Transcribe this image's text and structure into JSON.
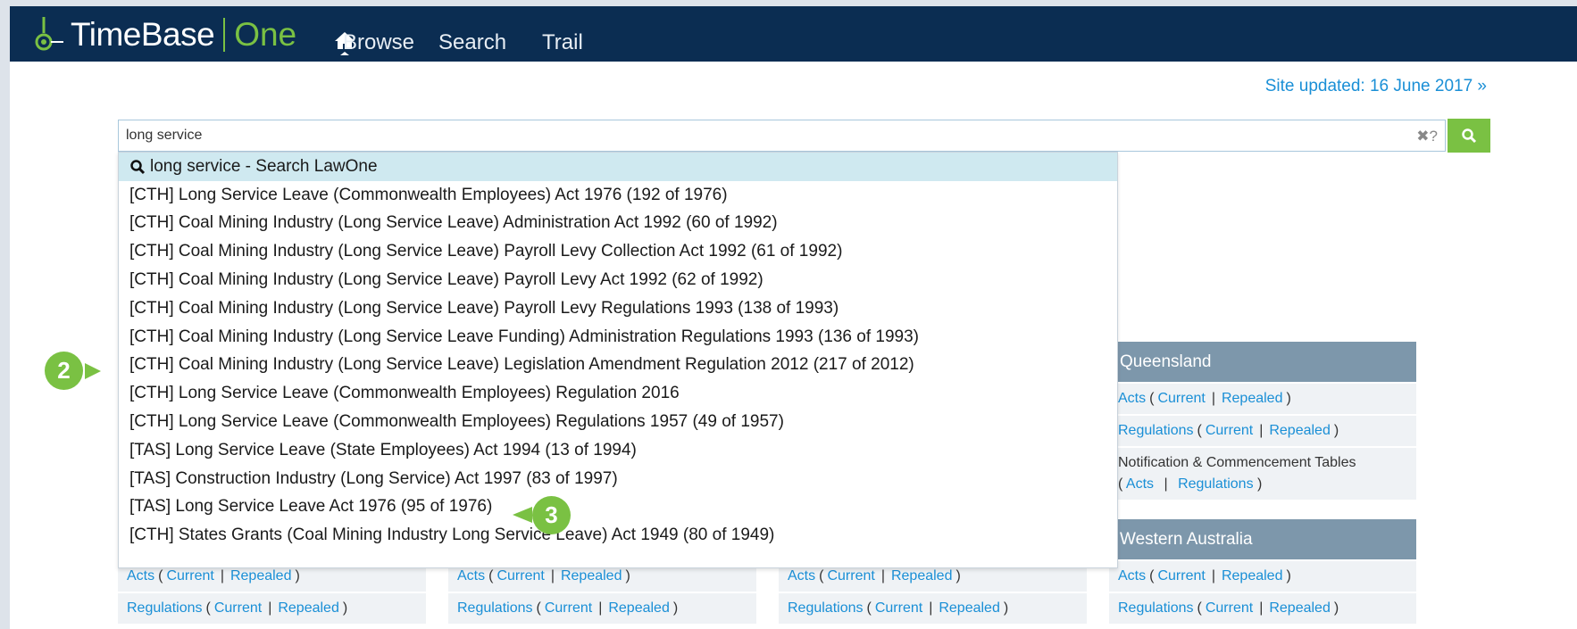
{
  "header": {
    "logo_text": "TimeBase",
    "logo_one": "One",
    "nav": [
      {
        "label": "Browse"
      },
      {
        "label": "Search"
      },
      {
        "label": "Trail"
      }
    ]
  },
  "site_updated": "Site updated: 16 June 2017 »",
  "search": {
    "value": "long service",
    "clear_help": "✖?"
  },
  "dropdown": {
    "suggest_label": "long service - Search LawOne",
    "items": [
      "[CTH] Long Service Leave (Commonwealth Employees) Act 1976 (192 of 1976)",
      "[CTH] Coal Mining Industry (Long Service Leave) Administration Act 1992 (60 of 1992)",
      "[CTH] Coal Mining Industry (Long Service Leave) Payroll Levy Collection Act 1992 (61 of 1992)",
      "[CTH] Coal Mining Industry (Long Service Leave) Payroll Levy Act 1992 (62 of 1992)",
      "[CTH] Coal Mining Industry (Long Service Leave) Payroll Levy Regulations 1993 (138 of 1993)",
      "[CTH] Coal Mining Industry (Long Service Leave Funding) Administration Regulations 1993 (136 of 1993)",
      "[CTH] Coal Mining Industry (Long Service Leave) Legislation Amendment Regulation 2012 (217 of 2012)",
      "[CTH] Long Service Leave (Commonwealth Employees) Regulation 2016",
      "[CTH] Long Service Leave (Commonwealth Employees) Regulations 1957 (49 of 1957)",
      "[TAS] Long Service Leave (State Employees) Act 1994 (13 of 1994)",
      "[TAS] Construction Industry (Long Service) Act 1997 (83 of 1997)",
      "[TAS] Long Service Leave Act 1976 (95 of 1976)",
      "[CTH] States Grants (Coal Mining Industry Long Service Leave) Act 1949 (80 of 1949)"
    ]
  },
  "jurisdictions": {
    "queensland": {
      "title": "Queensland",
      "acts": "Acts",
      "regulations": "Regulations",
      "current": "Current",
      "repealed": "Repealed",
      "notification": "Notification & Commencement Tables",
      "n_acts": "Acts",
      "n_regulations": "Regulations"
    },
    "western_australia": {
      "title": "Western Australia",
      "acts": "Acts",
      "regulations": "Regulations",
      "current": "Current",
      "repealed": "Repealed"
    }
  },
  "bottom_rows": {
    "acts": "Acts",
    "regulations": "Regulations",
    "current": "Current",
    "repealed": "Repealed"
  },
  "markers": {
    "m2": "2",
    "m3": "3"
  },
  "colors": {
    "topbar": "#0b2d52",
    "accent_green": "#7ac143",
    "link_blue": "#1a8fd6",
    "card_header": "#7d97ab",
    "suggest_highlight": "#cfe9f0"
  }
}
